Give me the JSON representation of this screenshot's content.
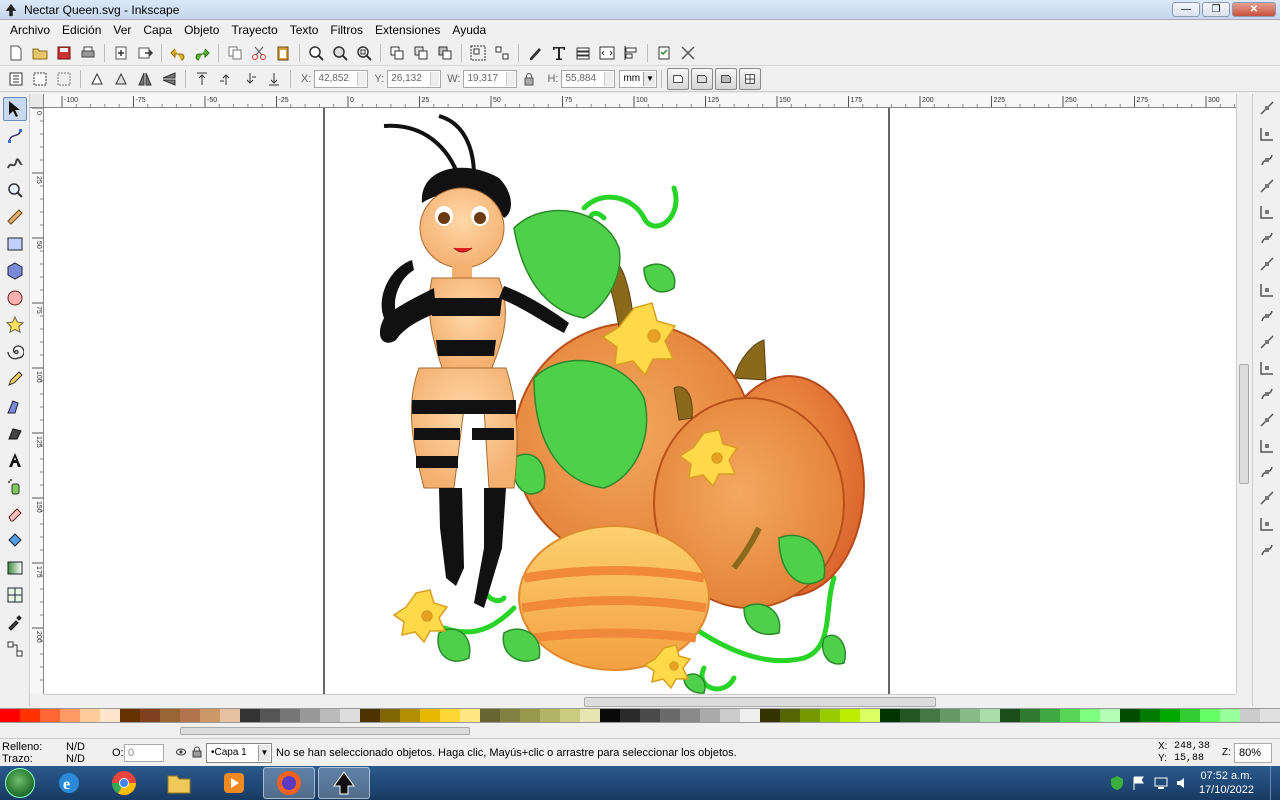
{
  "window": {
    "title": "Nectar Queen.svg - Inkscape",
    "minimize": "—",
    "restore": "❐",
    "close": "✕"
  },
  "menu": [
    "Archivo",
    "Edición",
    "Ver",
    "Capa",
    "Objeto",
    "Trayecto",
    "Texto",
    "Filtros",
    "Extensiones",
    "Ayuda"
  ],
  "commands": [
    "new-document",
    "open",
    "save",
    "print",
    "import",
    "export",
    "undo",
    "redo",
    "copy",
    "cut",
    "paste",
    "zoom-selection",
    "zoom-drawing",
    "zoom-page",
    "duplicate",
    "clone",
    "unlink-clone",
    "group",
    "ungroup",
    "fill-stroke",
    "text-font",
    "layers",
    "xml-editor",
    "align-distribute",
    "preferences",
    "document-properties"
  ],
  "selector_controls": {
    "x_label": "X:",
    "x_value": "42,852",
    "y_label": "Y:",
    "y_value": "26,132",
    "w_label": "W:",
    "w_value": "19,317",
    "h_label": "H:",
    "h_value": "55,884",
    "unit": "mm"
  },
  "hruler_ticks": [
    "-100",
    "-75",
    "-50",
    "-25",
    "0",
    "25",
    "50",
    "75",
    "100",
    "125",
    "150",
    "175",
    "200",
    "225",
    "250",
    "275",
    "300",
    "325"
  ],
  "vruler_ticks": [
    "0",
    "25",
    "50",
    "75",
    "100",
    "125",
    "150",
    "175",
    "200"
  ],
  "tools": [
    "selector",
    "node",
    "tweak",
    "zoom",
    "measure",
    "rectangle",
    "3d-box",
    "ellipse",
    "star",
    "spiral",
    "pencil",
    "pen",
    "calligraphy",
    "text",
    "spray",
    "eraser",
    "paint-bucket",
    "gradient",
    "mesh",
    "dropper",
    "connector"
  ],
  "snap_tools": [
    "snap-enable",
    "snap-bbox",
    "snap-bbox-edge",
    "snap-bbox-corner",
    "snap-bbox-midpoint",
    "snap-bbox-center",
    "snap-nodes",
    "snap-path",
    "snap-intersection",
    "snap-cusp",
    "snap-smooth",
    "snap-midpoint",
    "snap-center",
    "snap-rotation",
    "snap-text-baseline",
    "snap-page",
    "snap-grid",
    "snap-guide"
  ],
  "palette": [
    "#ff0000",
    "#ff3300",
    "#ff6633",
    "#ff9966",
    "#ffcc99",
    "#ffe6cc",
    "#663300",
    "#804020",
    "#996633",
    "#b3734d",
    "#cc9966",
    "#e6c2a3",
    "#333333",
    "#555555",
    "#777777",
    "#999999",
    "#bbbbbb",
    "#dddddd",
    "#4d3300",
    "#806600",
    "#b38f00",
    "#e6b800",
    "#ffd633",
    "#ffe680",
    "#666633",
    "#808040",
    "#99994d",
    "#b3b366",
    "#cccc80",
    "#e6e6b3",
    "#0a0a0a",
    "#2a2a2a",
    "#4a4a4a",
    "#6a6a6a",
    "#8a8a8a",
    "#aaaaaa",
    "#cccccc",
    "#eeeeee",
    "#333300",
    "#556600",
    "#779900",
    "#99cc00",
    "#bbee00",
    "#ddff66",
    "#003300",
    "#225522",
    "#447744",
    "#669966",
    "#88bb88",
    "#aaddaa",
    "#1a4d1a",
    "#2e7a2e",
    "#40a840",
    "#55d455",
    "#7fff7f",
    "#b3ffb3",
    "#004d00",
    "#007a00",
    "#00a800",
    "#33cc33",
    "#66ff66",
    "#99ff99",
    "#cccccc",
    "#e0e0e0"
  ],
  "status": {
    "fill_label": "Relleno:",
    "fill_value": "N/D",
    "stroke_label": "Trazo:",
    "stroke_value": "N/D",
    "opacity_label": "O:",
    "opacity_value": "0",
    "layer": "•Capa 1",
    "message": "No se han seleccionado objetos. Haga clic, Mayús+clic o arrastre para seleccionar los objetos.",
    "x_label": "X:",
    "x_coord": "248,38",
    "y_label": "Y:",
    "y_coord": "15,88",
    "zoom_label": "Z:",
    "zoom": "80%"
  },
  "taskbar": {
    "apps": [
      "internet-explorer",
      "chrome",
      "file-explorer",
      "media-player",
      "firefox",
      "inkscape"
    ],
    "time": "07:52 a.m.",
    "date": "17/10/2022"
  },
  "colors": {
    "pumpkin_dark": "#d9602a",
    "pumpkin_mid": "#f08a3a",
    "pumpkin_light": "#f6b04a",
    "leaf": "#4fd04a",
    "vine": "#28d428",
    "flower": "#ffd94a"
  }
}
